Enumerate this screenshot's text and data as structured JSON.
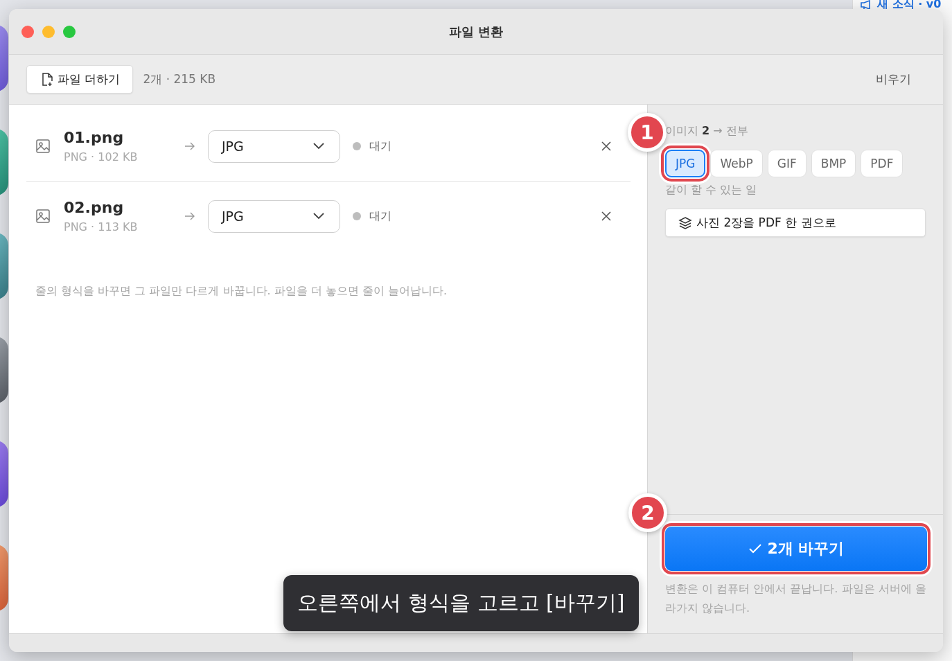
{
  "background": {
    "news_link": "새 소식 · v0"
  },
  "window": {
    "title": "파일 변환"
  },
  "toolbar": {
    "add_button": "파일 더하기",
    "summary": "2개 · 215 KB",
    "clear_button": "비우기"
  },
  "files": [
    {
      "name": "01.png",
      "meta": "PNG · 102 KB",
      "target": "JPG",
      "status": "대기"
    },
    {
      "name": "02.png",
      "meta": "PNG · 113 KB",
      "target": "JPG",
      "status": "대기"
    }
  ],
  "list_hint": "줄의 형식을 바꾸면 그 파일만 다르게 바꿉니다. 파일을 더 놓으면 줄이 늘어납니다.",
  "side_panel": {
    "heading": "이미지 **2** → 전부",
    "formats": [
      {
        "label": "JPG",
        "selected": true,
        "highlighted": true
      },
      {
        "label": "WebP",
        "selected": false,
        "highlighted": false
      },
      {
        "label": "GIF",
        "selected": false,
        "highlighted": false
      },
      {
        "label": "BMP",
        "selected": false,
        "highlighted": false
      },
      {
        "label": "PDF",
        "selected": false,
        "highlighted": false
      }
    ],
    "extras_heading": "같이 할 수 있는 일",
    "extras": [
      "사진 2장을 PDF 한 권으로"
    ],
    "convert_button": {
      "label": "2개 바꾸기",
      "highlighted": true
    },
    "note": "변환은 이 컴퓨터 안에서 끝납니다. 파일은 서버에 올라가지 않습니다."
  },
  "annotations": [
    {
      "number": "1"
    },
    {
      "number": "2"
    }
  ],
  "toast": "오른쪽에서 형식을 고르고 [바꾸기]"
}
